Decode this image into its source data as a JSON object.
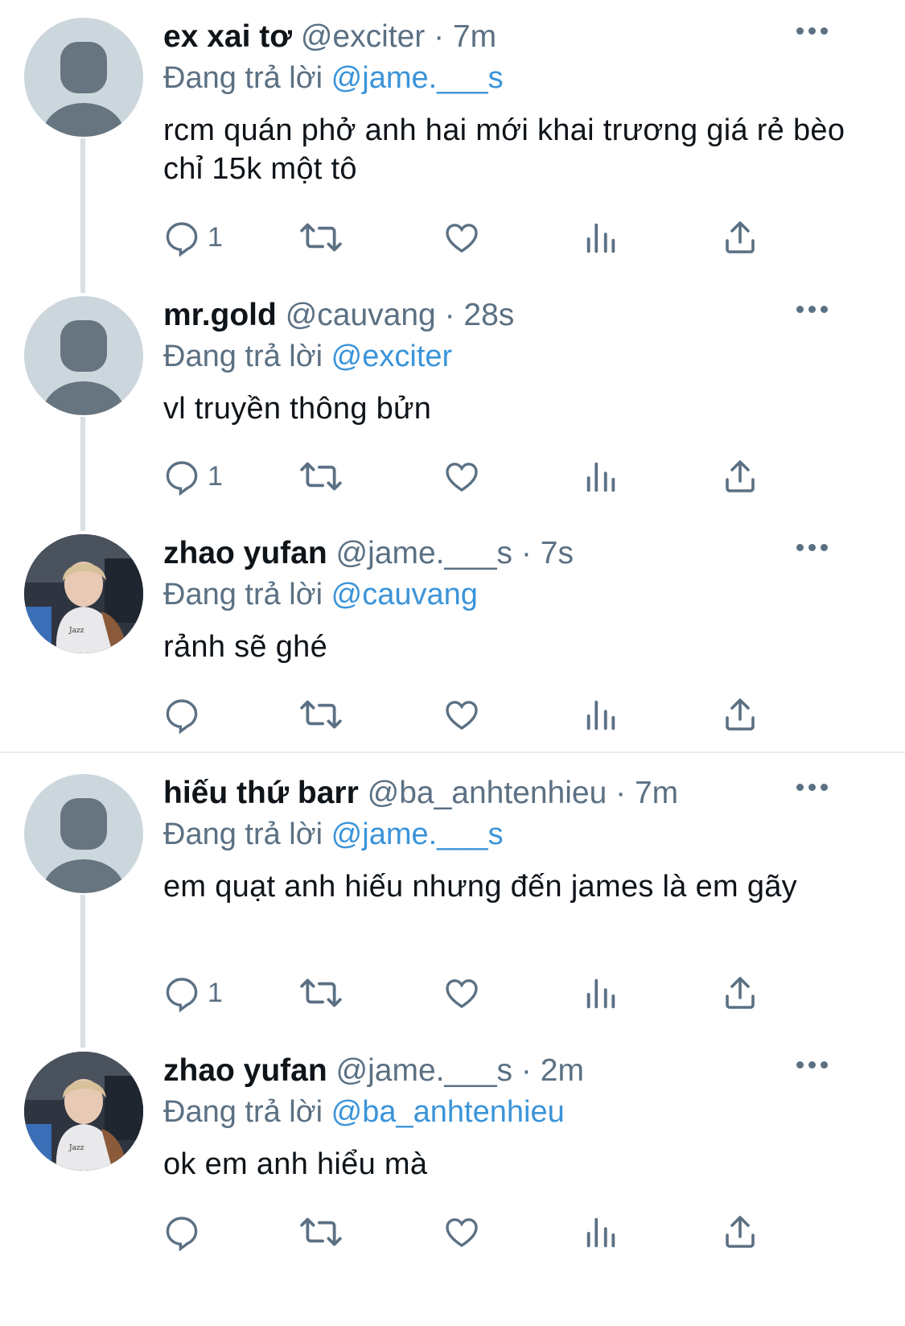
{
  "tweets": [
    {
      "name": "ex xai tơ",
      "handle": "@exciter",
      "dot": "·",
      "time": "7m",
      "reply_prefix": "Đang trả lời",
      "reply_to": "@jame.___s",
      "text": "rcm quán phở anh hai mới khai trương giá rẻ bèo chỉ 15k một tô",
      "reply_count": "1",
      "avatar": "default-avatar"
    },
    {
      "name": "mr.gold",
      "handle": "@cauvang",
      "dot": "·",
      "time": "28s",
      "reply_prefix": "Đang trả lời",
      "reply_to": "@exciter",
      "text": "vl truyền thông bửn",
      "reply_count": "1",
      "avatar": "default-avatar"
    },
    {
      "name": "zhao yufan",
      "handle": "@jame.___s",
      "dot": "·",
      "time": "7s",
      "reply_prefix": "Đang trả lời",
      "reply_to": "@cauvang",
      "text": "rảnh sẽ ghé",
      "reply_count": "",
      "avatar": "photo-avatar"
    },
    {
      "name": "hiếu thứ barr",
      "handle": "@ba_anhtenhieu",
      "dot": "·",
      "time": "7m",
      "reply_prefix": "Đang trả lời",
      "reply_to": "@jame.___s",
      "text": "em quạt anh hiếu nhưng đến james là em gãy",
      "reply_count": "1",
      "avatar": "default-avatar"
    },
    {
      "name": "zhao yufan",
      "handle": "@jame.___s",
      "dot": "·",
      "time": "2m",
      "reply_prefix": "Đang trả lời",
      "reply_to": "@ba_anhtenhieu",
      "text": "ok em anh hiểu mà",
      "reply_count": "",
      "avatar": "photo-avatar"
    }
  ],
  "icons": {
    "reply": "reply-icon",
    "retweet": "retweet-icon",
    "like": "heart-icon",
    "analytics": "analytics-icon",
    "share": "share-icon",
    "more": "more-icon"
  },
  "colors": {
    "mention": "#3b94d9",
    "secondary": "#5b7083",
    "line": "#d9dfe3",
    "avatar_bg": "#ccd6dd"
  }
}
